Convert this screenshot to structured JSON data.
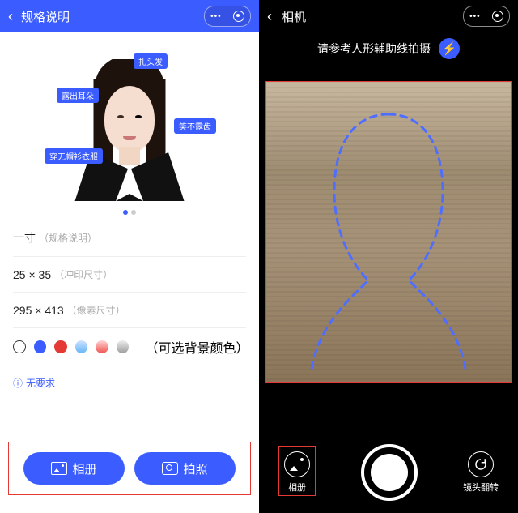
{
  "left": {
    "header": {
      "title": "规格说明"
    },
    "tips": {
      "hair": "扎头发",
      "ears": "露出耳朵",
      "teeth": "笑不露齿",
      "clothes": "穿无帽衫衣服"
    },
    "specs": {
      "name": "一寸",
      "name_hint": "（规格说明）",
      "print": "25 × 35",
      "print_hint": "（冲印尺寸）",
      "pixel": "295 × 413",
      "pixel_hint": "（像素尺寸）"
    },
    "colors": {
      "swatches": [
        "outline",
        "#3B5CFF",
        "#E53935",
        "#64B5F6",
        "#EF9A9A",
        "#BDBDBD"
      ],
      "hint": "（可选背景颜色）"
    },
    "notice": "无要求",
    "buttons": {
      "gallery": "相册",
      "camera": "拍照"
    }
  },
  "right": {
    "header": {
      "title": "相机"
    },
    "hint": "请参考人形辅助线拍摄",
    "toolbar": {
      "gallery": "相册",
      "flip": "镜头翻转"
    }
  }
}
